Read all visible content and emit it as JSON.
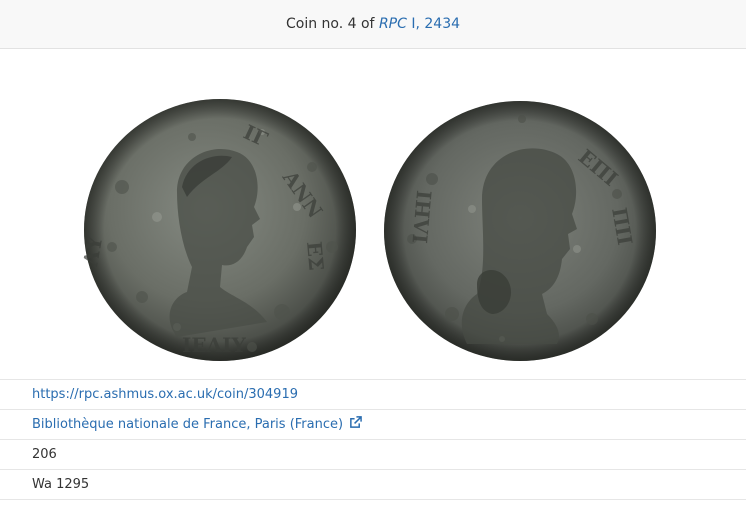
{
  "header": {
    "prefix": "Coin no. 4 of",
    "ref_series": "RPC",
    "ref_rest": "I, 2434"
  },
  "images": {
    "obverse_icon": "coin-obverse-image",
    "reverse_icon": "coin-reverse-image"
  },
  "details": {
    "url": "https://rpc.ashmus.ox.ac.uk/coin/304919",
    "collection": "Bibliothèque nationale de France, Paris (France)",
    "collection_icon": "external-link-icon",
    "number": "206",
    "reference": "Wa 1295"
  },
  "colors": {
    "link": "#2a6db0",
    "header_bg": "#f8f8f8",
    "coin_dark": "#3a3d38",
    "coin_mid": "#6b6f68",
    "coin_light": "#8d918a"
  }
}
